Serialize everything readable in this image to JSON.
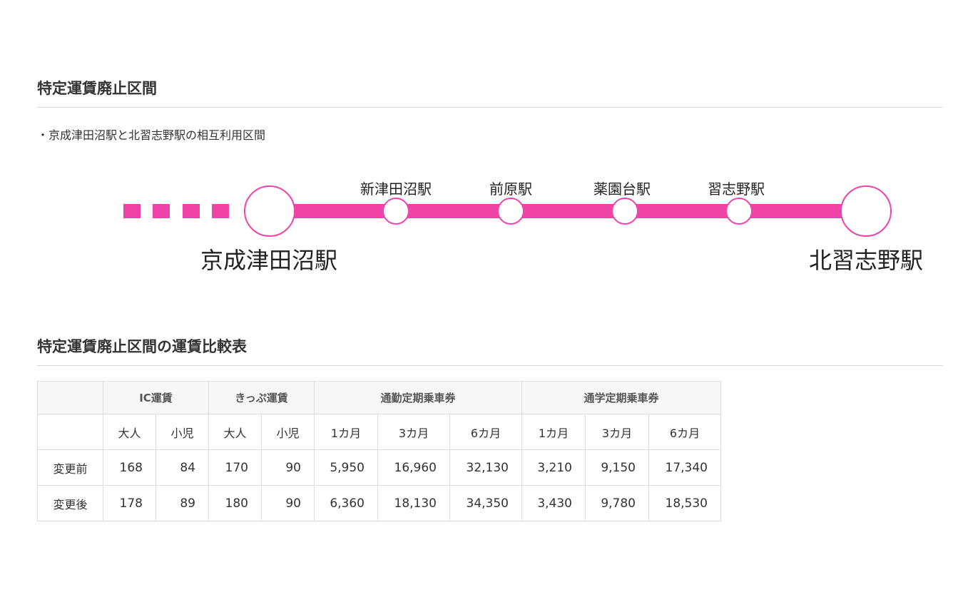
{
  "section1": {
    "title": "特定運賃廃止区間",
    "note": "・京成津田沼駅と北習志野駅の相互利用区間"
  },
  "route": {
    "line_color": "#ee44a8",
    "start_station": "京成津田沼駅",
    "end_station": "北習志野駅",
    "intermediate_stations": [
      "新津田沼駅",
      "前原駅",
      "薬園台駅",
      "習志野駅"
    ]
  },
  "section2": {
    "title": "特定運賃廃止区間の運賃比較表"
  },
  "table": {
    "groups": [
      "IC運賃",
      "きっぷ運賃",
      "通勤定期乗車券",
      "通学定期乗車券"
    ],
    "subheaders": [
      "大人",
      "小児",
      "大人",
      "小児",
      "1カ月",
      "3カ月",
      "6カ月",
      "1カ月",
      "3カ月",
      "6カ月"
    ],
    "rows": [
      {
        "label": "変更前",
        "cells": [
          "168",
          "84",
          "170",
          "90",
          "5,950",
          "16,960",
          "32,130",
          "3,210",
          "9,150",
          "17,340"
        ]
      },
      {
        "label": "変更後",
        "cells": [
          "178",
          "89",
          "180",
          "90",
          "6,360",
          "18,130",
          "34,350",
          "3,430",
          "9,780",
          "18,530"
        ]
      }
    ]
  }
}
